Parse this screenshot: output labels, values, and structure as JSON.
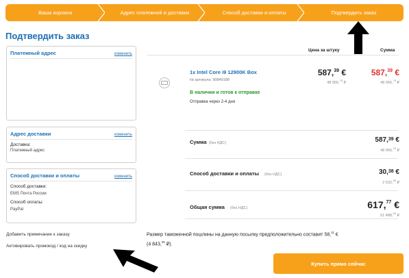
{
  "steps": [
    {
      "label": "Ваша корзина"
    },
    {
      "label": "Адрес платежной и доставки"
    },
    {
      "label": "Способ доставки и оплаты"
    },
    {
      "label": "Подтвердить заказ"
    }
  ],
  "page_title": "Подтвердить заказ",
  "billing": {
    "title": "Платежный адрес",
    "edit": "изменить"
  },
  "delivery": {
    "title": "Адрес доставки",
    "edit": "изменить",
    "label": "Доставка:",
    "value": "Платежный адрес"
  },
  "shipping": {
    "title": "Способ доставки и оплаты",
    "edit": "изменить",
    "ship_label": "Способ доставки:",
    "ship_value": "EMS Почта России",
    "pay_label": "Способ оплаты:",
    "pay_value": "PayPal"
  },
  "links": {
    "note": "Добавить примечание к заказу",
    "promo": "Активировать промокод / код на скидку"
  },
  "columns": {
    "unit_price": "Цена за штуку",
    "total": "Сумма"
  },
  "product": {
    "name": "1x Intel Core i9 12900K Box",
    "sku": "№ артикула: 90849188",
    "stock": "В наличии и готов к отправке",
    "ship_time": "Отправка через 2-4 дня",
    "thumb_icon": "product-thumbnail",
    "unit_price_int": "587,",
    "unit_price_dec": "39",
    "unit_price_cur": " €",
    "unit_rub_int": "48 956,",
    "unit_rub_dec": "78",
    "unit_rub_cur": " ₽",
    "total_int": "587,",
    "total_dec": "39",
    "total_cur": " €",
    "total_rub_int": "48 956,",
    "total_rub_dec": "78",
    "total_rub_cur": " ₽"
  },
  "summary": {
    "subtotal_label": "Сумма",
    "subtotal_vat": "(без НДС)",
    "subtotal_int": "587,",
    "subtotal_dec": "39",
    "subtotal_cur": " €",
    "subtotal_rub_int": "48 956,",
    "subtotal_rub_dec": "78",
    "subtotal_rub_cur": " ₽",
    "shipping_label": "Способ доставки и оплаты",
    "shipping_vat": "(без НДС)",
    "shipping_int": "30,",
    "shipping_dec": "38",
    "shipping_cur": " €",
    "shipping_rub_int": "2 532,",
    "shipping_rub_dec": "98",
    "shipping_rub_cur": " ₽",
    "grand_label": "Общая сумма",
    "grand_vat": "(без НДС)",
    "grand_int": "617,",
    "grand_dec": "77",
    "grand_cur": " €",
    "grand_rub_int": "51 488,",
    "grand_rub_dec": "50",
    "grand_rub_cur": " ₽"
  },
  "customs": {
    "text_a": "Размер таможенной пошлины на данную посылку предположительно составит 58,",
    "sup_a": "11",
    "text_b": " €",
    "text_c": "(4 843,",
    "sup_b": "25",
    "text_d": " ₽)."
  },
  "buy_button": "Купить прямо сейчас",
  "colors": {
    "accent": "#f7a11a",
    "link": "#1c6fb5",
    "price_red": "#e0322d",
    "stock_green": "#2a9a2a"
  }
}
